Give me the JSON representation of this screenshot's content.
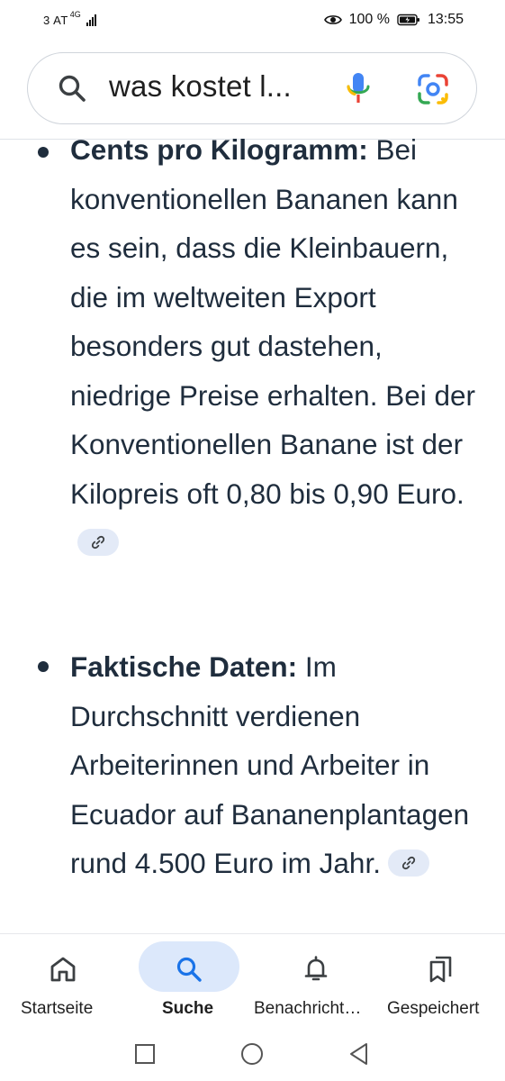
{
  "status_bar": {
    "carrier": "3 AT",
    "network": "4G",
    "battery_percent": "100 %",
    "time": "13:55"
  },
  "search": {
    "query": "was kostet l..."
  },
  "bullets": [
    {
      "bold": "Cents pro Kilogramm:",
      "text": " Bei konventionellen Bananen kann es sein, dass die Kleinbauern, die im weltweiten Export besonders gut dastehen, niedrige Preise erhalten. Bei der Konventionellen Banane ist der Kilopreis oft 0,80 bis 0,90 Euro."
    },
    {
      "bold": "Faktische Daten:",
      "text": " Im Durchschnitt verdienen Arbeiterinnen und Arbeiter in Ecuador auf Bananenplantagen rund 4.500 Euro im Jahr."
    }
  ],
  "bottom_nav": {
    "items": [
      {
        "label": "Startseite",
        "icon": "home-icon"
      },
      {
        "label": "Suche",
        "icon": "search-icon",
        "active": true
      },
      {
        "label": "Benachricht…",
        "icon": "bell-icon"
      },
      {
        "label": "Gespeichert",
        "icon": "bookmarks-icon"
      }
    ]
  },
  "colors": {
    "text": "#1f2d3d",
    "accent": "#1a73e8",
    "pill": "#dce8fb"
  }
}
